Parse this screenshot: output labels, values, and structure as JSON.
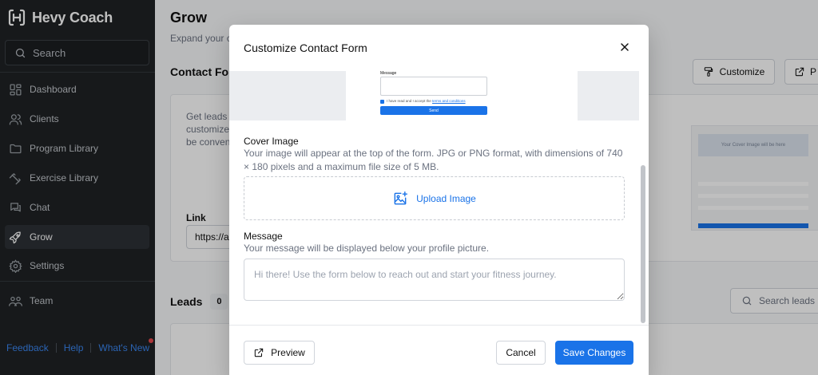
{
  "app": {
    "name": "Hevy Coach"
  },
  "sidebar": {
    "search_label": "Search",
    "items": [
      {
        "label": "Dashboard",
        "icon": "dashboard-icon"
      },
      {
        "label": "Clients",
        "icon": "clients-icon"
      },
      {
        "label": "Program Library",
        "icon": "folder-icon"
      },
      {
        "label": "Exercise Library",
        "icon": "dumbbell-icon"
      },
      {
        "label": "Chat",
        "icon": "chat-icon"
      },
      {
        "label": "Grow",
        "icon": "rocket-icon",
        "active": true
      },
      {
        "label": "Settings",
        "icon": "gear-icon"
      },
      {
        "label": "Team",
        "icon": "team-icon"
      }
    ],
    "footer": {
      "feedback": "Feedback",
      "help": "Help",
      "whats_new": "What's New"
    }
  },
  "main": {
    "title": "Grow",
    "subtitle": "Expand your c",
    "contact_form_title": "Contact Fo",
    "customize_label": "Customize",
    "preview_label": "P",
    "card_description": "Get leads b customized be conveni",
    "link_label": "Link",
    "link_value": "https://a",
    "form_preview_cover": "Your Cover Image will be here",
    "leads_title": "Leads",
    "leads_count": "0",
    "search_leads_placeholder": "Search leads"
  },
  "modal": {
    "title": "Customize Contact Form",
    "preview": {
      "message_label": "Message",
      "terms_prefix": "I have read and I accept the ",
      "terms_link": "terms and conditions",
      "send_label": "Send"
    },
    "cover_image": {
      "label": "Cover Image",
      "help": "Your image will appear at the top of the form. JPG or PNG format, with dimensions of 740 × 180 pixels and a maximum file size of 5 MB.",
      "upload_label": "Upload Image"
    },
    "message": {
      "label": "Message",
      "help": "Your message will be displayed below your profile picture.",
      "placeholder": "Hi there! Use the form below to reach out and start your fitness journey.",
      "value": ""
    },
    "footer": {
      "preview_label": "Preview",
      "cancel_label": "Cancel",
      "save_label": "Save Changes"
    }
  },
  "colors": {
    "accent": "#1a73e8",
    "sidebar_bg": "#1f2225",
    "notification_dot": "#e5484d"
  }
}
